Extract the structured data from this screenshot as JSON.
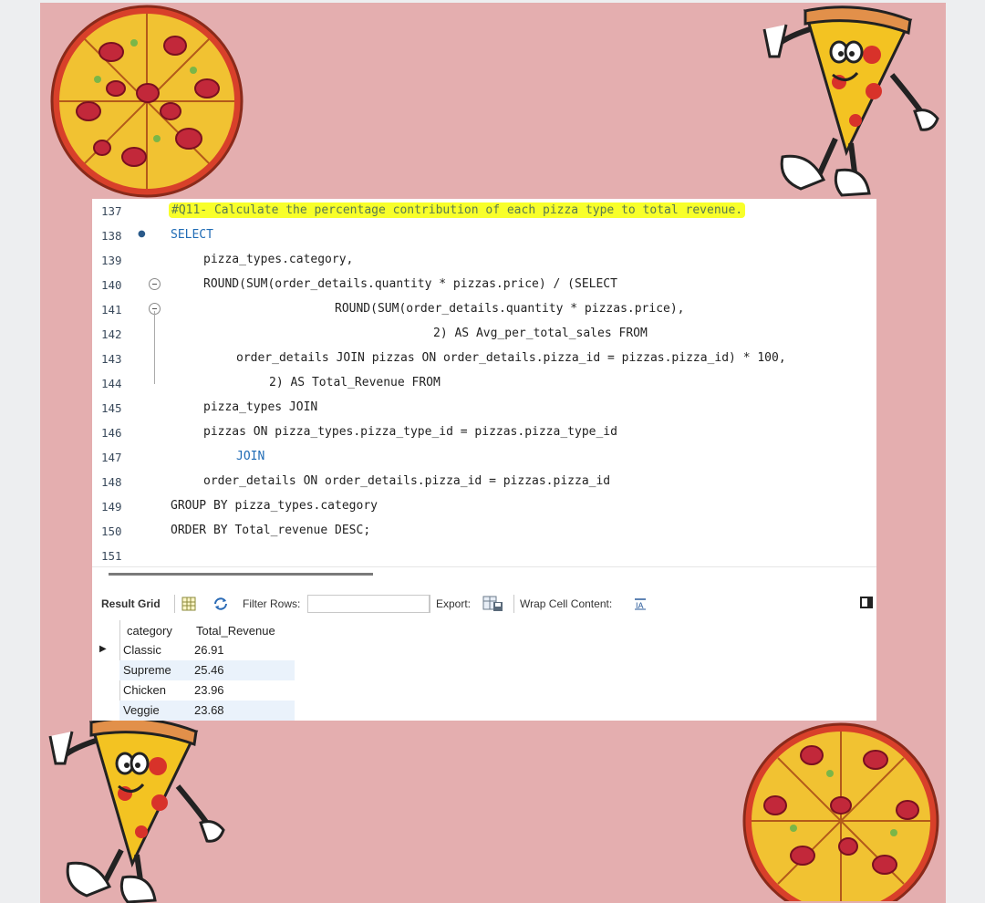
{
  "editor": {
    "lines": [
      {
        "n": "137",
        "code": "#Q11- Calculate the percentage contribution of each pizza type to total revenue."
      },
      {
        "n": "138",
        "code": "SELECT"
      },
      {
        "n": "139",
        "code": "pizza_types.category,"
      },
      {
        "n": "140",
        "code": "ROUND(SUM(order_details.quantity * pizzas.price) / (SELECT"
      },
      {
        "n": "141",
        "code": "ROUND(SUM(order_details.quantity * pizzas.price),"
      },
      {
        "n": "142",
        "code": "2) AS Avg_per_total_sales FROM"
      },
      {
        "n": "143",
        "code": "order_details JOIN pizzas ON order_details.pizza_id = pizzas.pizza_id) * 100,"
      },
      {
        "n": "144",
        "code": "2) AS Total_Revenue FROM"
      },
      {
        "n": "145",
        "code": "pizza_types JOIN"
      },
      {
        "n": "146",
        "code": "pizzas ON pizza_types.pizza_type_id = pizzas.pizza_type_id"
      },
      {
        "n": "147",
        "code": "JOIN"
      },
      {
        "n": "148",
        "code": "order_details ON order_details.pizza_id = pizzas.pizza_id"
      },
      {
        "n": "149",
        "code": "GROUP BY pizza_types.category"
      },
      {
        "n": "150",
        "code": "ORDER BY Total_revenue DESC;"
      },
      {
        "n": "151",
        "code": ""
      }
    ]
  },
  "toolbar": {
    "result_grid": "Result Grid",
    "filter_rows": "Filter Rows:",
    "filter_value": "",
    "export": "Export:",
    "wrap_cell": "Wrap Cell Content:"
  },
  "grid": {
    "headers": [
      "category",
      "Total_Revenue"
    ],
    "rows": [
      [
        "Classic",
        "26.91"
      ],
      [
        "Supreme",
        "25.46"
      ],
      [
        "Chicken",
        "23.96"
      ],
      [
        "Veggie",
        "23.68"
      ]
    ]
  },
  "colors": {
    "background": "#e4aeaf",
    "highlight": "#f8ff2a",
    "keyword": "#1f6bb5",
    "number": "#e07a20"
  },
  "icons": [
    "pizza-whole-icon",
    "pizza-slice-character-icon",
    "grid-layout-icon",
    "filter-refresh-icon",
    "export-icon",
    "wrap-text-icon",
    "maximize-icon",
    "row-pointer-icon"
  ]
}
